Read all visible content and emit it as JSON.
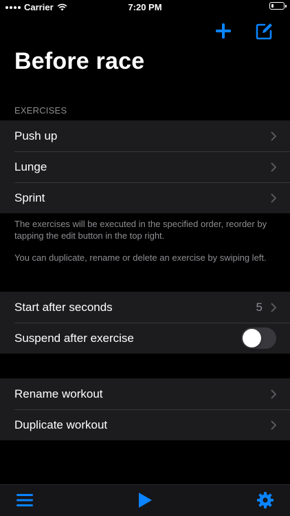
{
  "status_bar": {
    "carrier": "Carrier",
    "time": "7:20 PM"
  },
  "colors": {
    "accent": "#0a84ff",
    "background": "#000000",
    "cell": "#1c1c1e",
    "secondary_text": "#8e8e93"
  },
  "nav": {
    "add_icon": "plus-icon",
    "edit_icon": "compose-icon"
  },
  "page_title": "Before race",
  "exercises": {
    "header": "EXERCISES",
    "items": [
      "Push up",
      "Lunge",
      "Sprint"
    ],
    "footer_1": "The exercises will be executed in the specified order, reorder by tapping the edit button in the top right.",
    "footer_2": "You can duplicate, rename or delete an exercise by swiping left."
  },
  "settings": {
    "start_after_label": "Start after seconds",
    "start_after_value": "5",
    "suspend_label": "Suspend after exercise",
    "suspend_on": false
  },
  "actions": {
    "rename_label": "Rename workout",
    "duplicate_label": "Duplicate workout"
  },
  "tab_bar": {
    "menu_icon": "hamburger-menu-icon",
    "play_icon": "play-icon",
    "settings_icon": "gear-icon"
  }
}
